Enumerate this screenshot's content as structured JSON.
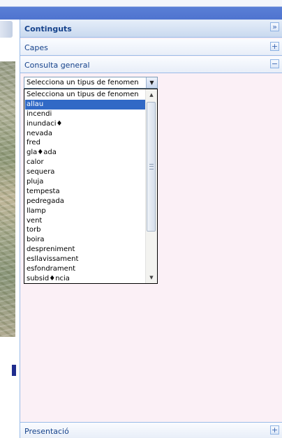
{
  "panel": {
    "contents_title": "Continguts",
    "collapse_symbol": "»",
    "sections": {
      "layers": {
        "label": "Capes",
        "toggle": "+"
      },
      "general_query": {
        "label": "Consulta general",
        "toggle": "−"
      },
      "presentation": {
        "label": "Presentació",
        "toggle": "+"
      }
    }
  },
  "phenomenon_select": {
    "value": "Selecciona un tipus de fenomen",
    "options": [
      "Selecciona un tipus de fenomen",
      "allau",
      "incendi",
      "inundaci♦",
      "nevada",
      "fred",
      "gla♦ada",
      "calor",
      "sequera",
      "pluja",
      "tempesta",
      "pedregada",
      "llamp",
      "vent",
      "torb",
      "boira",
      "despreniment",
      "esllavissament",
      "esfondrament",
      "subsid♦ncia"
    ],
    "selected_index": 1
  },
  "icons": {
    "dropdown_arrow": "chevron-down-icon",
    "scroll_up": "arrow-up-icon",
    "scroll_down": "arrow-down-icon"
  },
  "colors": {
    "selection": "#3169c6",
    "panel_header_text": "#15428b",
    "panel_background": "#fbf0f6",
    "top_bar": "#4f74cf"
  }
}
